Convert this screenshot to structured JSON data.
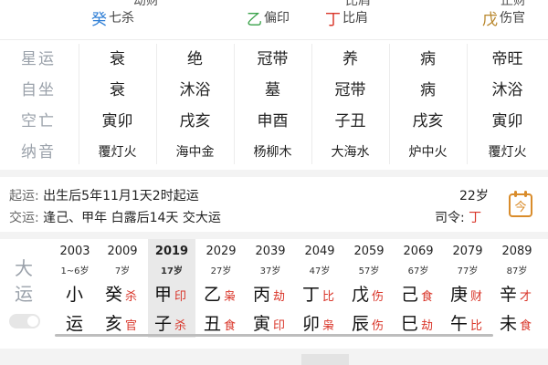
{
  "topstrip": {
    "cells": [
      {
        "glyph": "癸",
        "glyph_color": "#2f7fd6",
        "text": "七杀"
      },
      {
        "glyph": "乙",
        "glyph_color": "#3aa24a",
        "text": "偏印"
      },
      {
        "glyph": "丁",
        "glyph_color": "#d9362a",
        "text": "比肩"
      },
      {
        "glyph": "戊",
        "glyph_color": "#b8862b",
        "text": "伤官"
      }
    ],
    "partials": [
      "劫财",
      "",
      "比肩",
      "",
      "正财"
    ]
  },
  "pillars": {
    "row_labels": [
      "星运",
      "自坐",
      "空亡",
      "纳音"
    ],
    "rows": [
      [
        "衰",
        "绝",
        "冠带",
        "养",
        "病",
        "帝旺"
      ],
      [
        "衰",
        "沐浴",
        "墓",
        "冠带",
        "病",
        "沐浴"
      ],
      [
        "寅卯",
        "戌亥",
        "申酉",
        "子丑",
        "戌亥",
        "寅卯"
      ],
      [
        "覆灯火",
        "海中金",
        "杨柳木",
        "大海水",
        "炉中火",
        "覆灯火"
      ]
    ]
  },
  "luck_info": {
    "qiyun_label": "起运:",
    "qiyun_text": "出生后5年11月1天2时起运",
    "jiaoyun_label": "交运:",
    "jiaoyun_text": "逢己、甲年 白露后14天 交大运",
    "age": "22岁",
    "siling_label": "司令:",
    "siling_value": "丁",
    "calendar_glyph": "今"
  },
  "dayun": {
    "label_top": "大",
    "label_bottom": "运",
    "columns": [
      {
        "year": "2003",
        "age": "1~6岁",
        "g": "小",
        "gs": "",
        "z": "运",
        "zs": "",
        "active": false
      },
      {
        "year": "2009",
        "age": "7岁",
        "g": "癸",
        "gs": "杀",
        "z": "亥",
        "zs": "官",
        "active": false
      },
      {
        "year": "2019",
        "age": "17岁",
        "g": "甲",
        "gs": "印",
        "z": "子",
        "zs": "杀",
        "active": true
      },
      {
        "year": "2029",
        "age": "27岁",
        "g": "乙",
        "gs": "枭",
        "z": "丑",
        "zs": "食",
        "active": false
      },
      {
        "year": "2039",
        "age": "37岁",
        "g": "丙",
        "gs": "劫",
        "z": "寅",
        "zs": "印",
        "active": false
      },
      {
        "year": "2049",
        "age": "47岁",
        "g": "丁",
        "gs": "比",
        "z": "卯",
        "zs": "枭",
        "active": false
      },
      {
        "year": "2059",
        "age": "57岁",
        "g": "戊",
        "gs": "伤",
        "z": "辰",
        "zs": "伤",
        "active": false
      },
      {
        "year": "2069",
        "age": "67岁",
        "g": "己",
        "gs": "食",
        "z": "巳",
        "zs": "劫",
        "active": false
      },
      {
        "year": "2079",
        "age": "77岁",
        "g": "庚",
        "gs": "财",
        "z": "午",
        "zs": "比",
        "active": false
      },
      {
        "year": "2089",
        "age": "87岁",
        "g": "辛",
        "gs": "才",
        "z": "未",
        "zs": "食",
        "active": false
      }
    ]
  }
}
